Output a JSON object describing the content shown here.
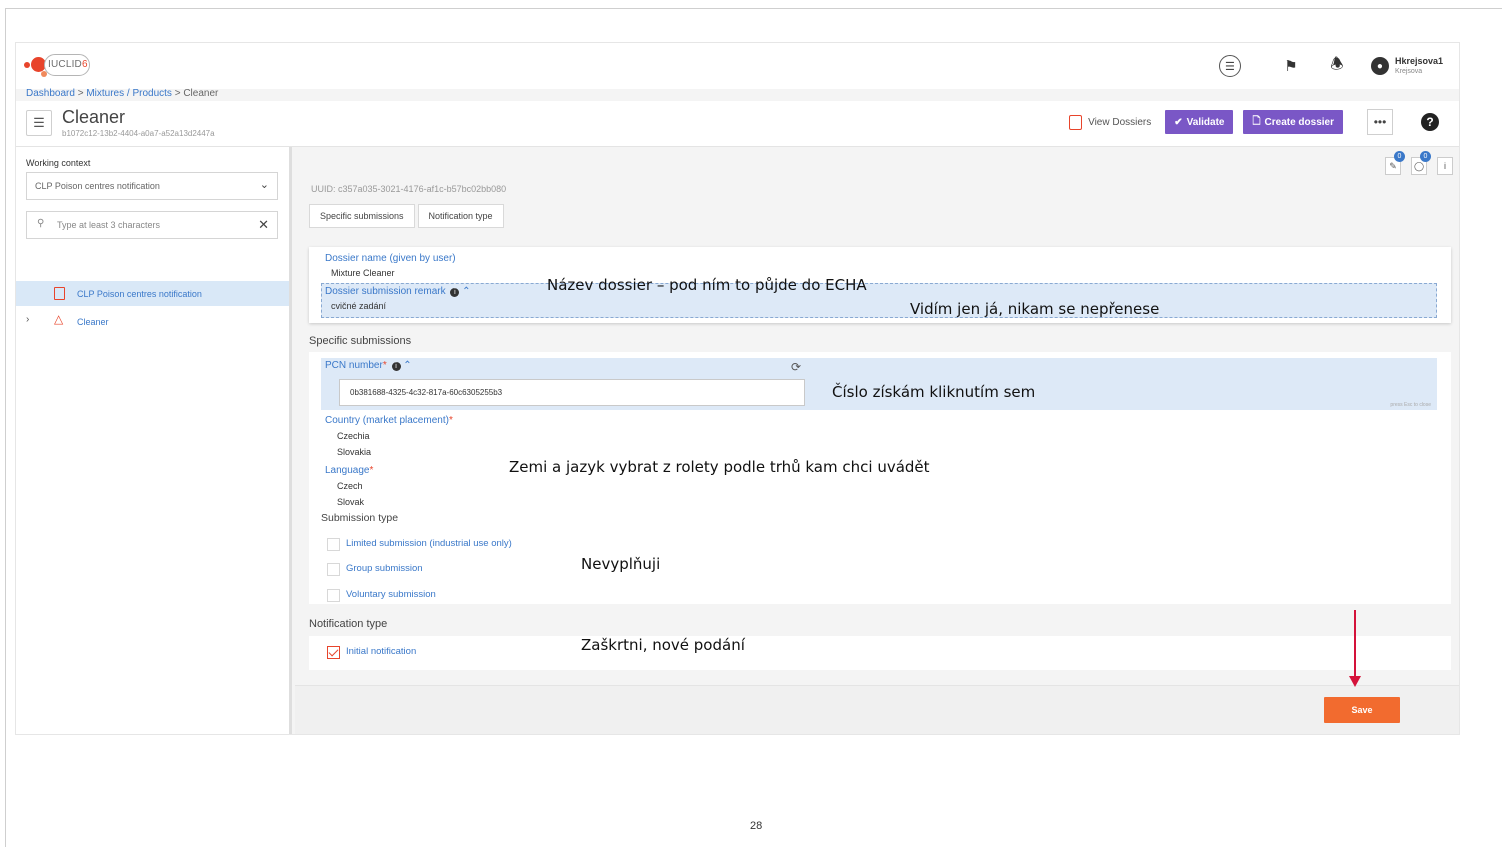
{
  "header": {
    "logo_text": "IUCLID",
    "logo_version": "6",
    "user_name": "Hkrejsova1",
    "user_sub": "Krejsova"
  },
  "breadcrumb": {
    "dashboard": "Dashboard",
    "sep1": " > ",
    "mixtures": "Mixtures / Products",
    "sep2": " > ",
    "current": "Cleaner"
  },
  "page": {
    "title": "Cleaner",
    "uuid": "b1072c12-13b2-4404-a0a7-a52a13d2447a"
  },
  "actions": {
    "view_dossiers": "View Dossiers",
    "validate": "Validate",
    "create_dossier": "Create dossier",
    "more": "•••",
    "help": "?"
  },
  "sidebar": {
    "working_context_label": "Working context",
    "working_context_value": "CLP Poison centres notification",
    "search_placeholder": "Type at least 3 characters",
    "tree_items": [
      {
        "label": "CLP Poison centres notification"
      },
      {
        "label": "Cleaner"
      }
    ]
  },
  "main": {
    "uuid_line": "UUID: c357a035-3021-4176-af1c-b57bc02bb080",
    "tabs": [
      "Specific submissions",
      "Notification type"
    ],
    "side_badges": [
      "0",
      "0"
    ],
    "dossier_name_label": "Dossier name (given by user)",
    "dossier_name_value": "Mixture Cleaner",
    "remark_label": "Dossier submission remark",
    "remark_value": "cvičné zadání",
    "specific_title": "Specific submissions",
    "pcn_label": "PCN number",
    "pcn_value": "0b381688-4325-4c32-817a-60c6305255b3",
    "pcn_hint": "press Esc to close",
    "country_label": "Country (market placement)",
    "countries": [
      "Czechia",
      "Slovakia"
    ],
    "language_label": "Language",
    "languages": [
      "Czech",
      "Slovak"
    ],
    "submission_type_label": "Submission type",
    "submission_types": [
      {
        "label": "Limited submission (industrial use only)",
        "checked": false
      },
      {
        "label": "Group submission",
        "checked": false
      },
      {
        "label": "Voluntary submission",
        "checked": false
      }
    ],
    "notification_title": "Notification type",
    "initial_notification": {
      "label": "Initial notification",
      "checked": true
    },
    "save": "Save"
  },
  "annotations": {
    "a1": "Název dossier – pod ním to půjde do ECHA",
    "a2": "Vidím jen já, nikam se nepřenese",
    "a3": "Číslo získám kliknutím sem",
    "a4": "Zemi a jazyk vybrat z rolety podle trhů kam chci uvádět",
    "a5": "Nevyplňuji",
    "a6": "Zaškrtni, nové podání"
  },
  "page_number": "28",
  "colors": {
    "accent_purple": "#7a57c6",
    "link_blue": "#3a78c9",
    "save_orange": "#f26b2f",
    "arrow_red": "#d4123a"
  }
}
